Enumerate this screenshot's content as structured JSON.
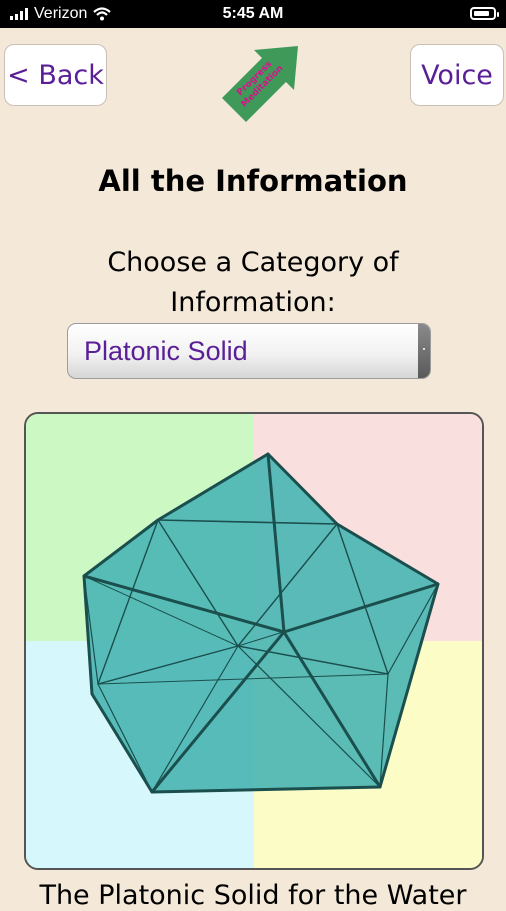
{
  "status_bar": {
    "carrier": "Verizon",
    "time": "5:45 AM",
    "battery_level": 0.85
  },
  "nav": {
    "back_label": "< Back",
    "voice_label": "Voice"
  },
  "logo": {
    "line1": "Progress",
    "line2": "Meditation",
    "arrow_color": "#3f9a5a",
    "text_color": "#d4148a"
  },
  "page": {
    "title": "All the Information",
    "prompt": "Choose a Category of Information:"
  },
  "category_picker": {
    "selected": "Platonic Solid"
  },
  "viewer": {
    "solid_name": "icosahedron",
    "solid_color": "#4cb6b3",
    "edge_color": "#1b4f4e",
    "quadrant_colors": [
      "#ccf8c4",
      "#f9dfde",
      "#d6f7fb",
      "#fbfcc6"
    ]
  },
  "caption": "The Platonic Solid for the Water"
}
